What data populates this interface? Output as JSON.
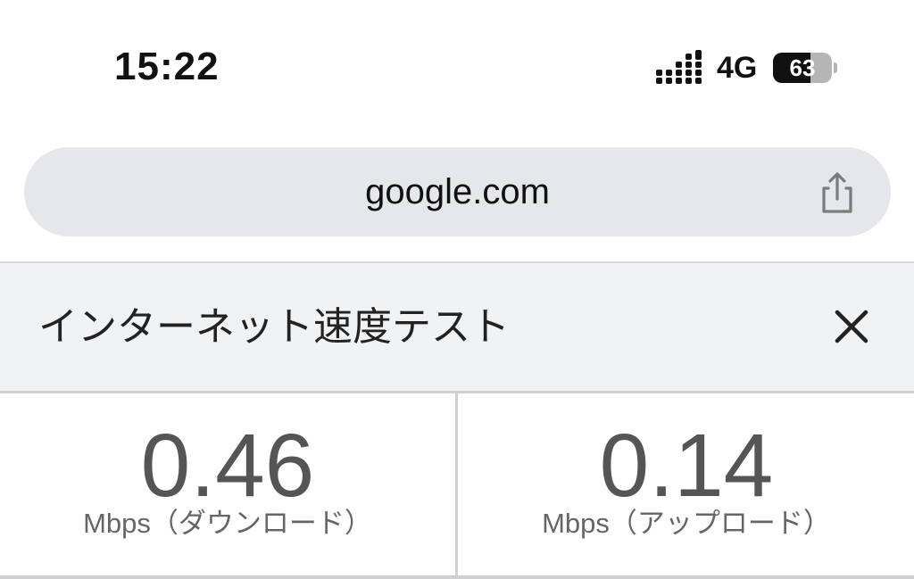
{
  "status_bar": {
    "time": "15:22",
    "network": "4G",
    "battery_level": "63",
    "battery_fraction": 0.63,
    "signal_icon": "signal-bars-icon",
    "battery_icon": "battery-icon"
  },
  "address_bar": {
    "url": "google.com",
    "share_icon": "share-icon"
  },
  "speed_test": {
    "title": "インターネット速度テスト",
    "close_icon": "close-icon",
    "download": {
      "value": "0.46",
      "unit": "Mbps（ダウンロード）"
    },
    "upload": {
      "value": "0.14",
      "unit": "Mbps（アップロード）"
    }
  },
  "colors": {
    "address_bar_bg": "#e6e7ea",
    "header_bg": "#f1f2f4",
    "value_text": "#555555",
    "divider": "#cfd0d3"
  }
}
